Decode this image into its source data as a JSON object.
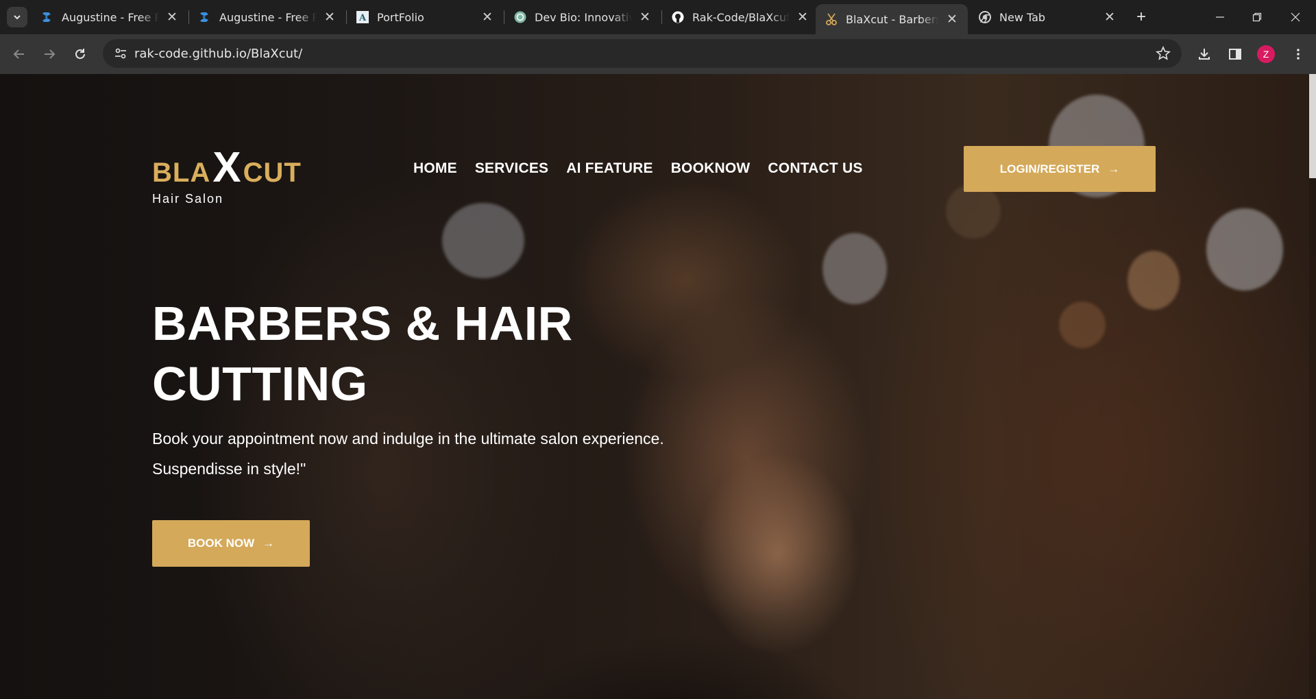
{
  "tabs": [
    {
      "title": "Augustine - Free Personal Portfolio",
      "favicon": "blue-s-icon",
      "active": false
    },
    {
      "title": "Augustine - Free Personal Portfolio",
      "favicon": "blue-s-icon",
      "active": false
    },
    {
      "title": "PortFolio",
      "favicon": "letter-a-icon",
      "active": false
    },
    {
      "title": "Dev Bio: Innovative Solutions",
      "favicon": "openai-icon",
      "active": false
    },
    {
      "title": "Rak-Code/BlaXcut",
      "favicon": "github-icon",
      "active": false
    },
    {
      "title": "BlaXcut - Barbers & Hair Salon",
      "favicon": "scissors-icon",
      "active": true
    },
    {
      "title": "New Tab",
      "favicon": "chrome-icon",
      "active": false
    }
  ],
  "toolbar": {
    "url": "rak-code.github.io/BlaXcut/",
    "profile_initial": "Z"
  },
  "site": {
    "logo": {
      "prefix": "BLA",
      "x": "X",
      "suffix": "CUT",
      "subtitle": "Hair Salon"
    },
    "nav": [
      "HOME",
      "SERVICES",
      "AI FEATURE",
      "BOOKNOW",
      "CONTACT US"
    ],
    "login_label": "LOGIN/REGISTER",
    "hero": {
      "title_line1": "BARBERS & HAIR",
      "title_line2": "CUTTING",
      "text_line1": "Book your appointment now and indulge in the ultimate salon experience.",
      "text_line2": "Suspendisse in style!\""
    },
    "book_label": "BOOK NOW"
  },
  "colors": {
    "accent": "#d4a95a",
    "logo_gold": "#d9ae5c",
    "browser_chrome": "#1f1f1f",
    "toolbar": "#363636",
    "avatar": "#d81b60"
  }
}
